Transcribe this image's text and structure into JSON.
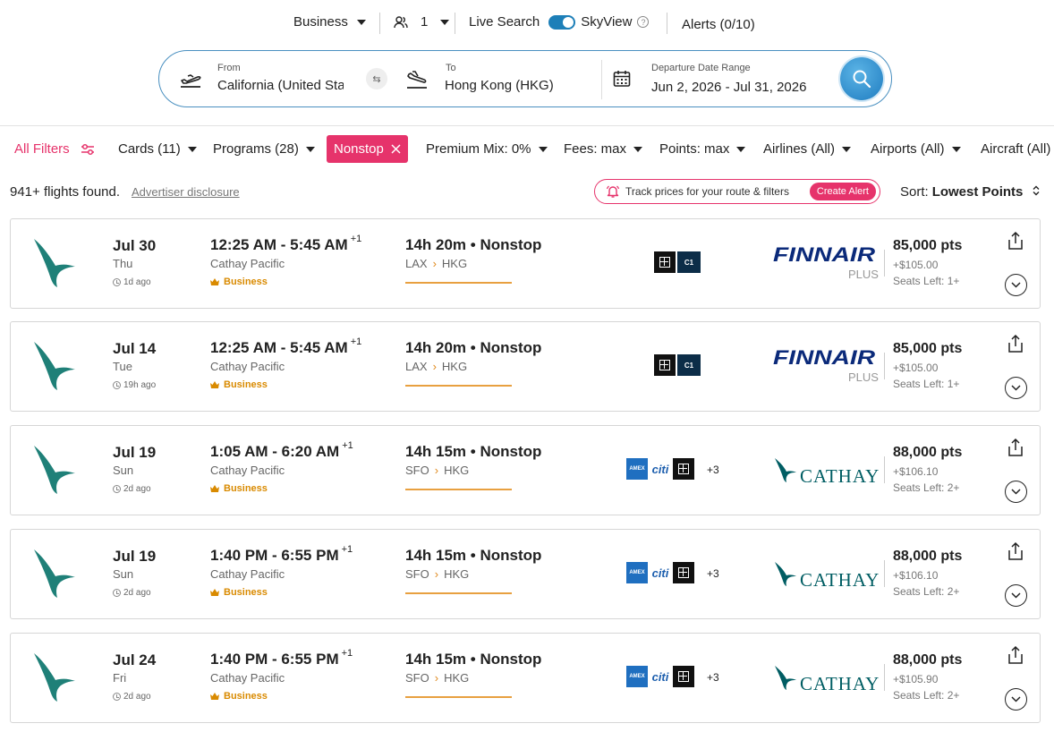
{
  "topbar": {
    "cabin": "Business",
    "passengers": "1",
    "live_search": "Live Search",
    "skyview": "SkyView",
    "alerts": "Alerts (0/10)"
  },
  "search": {
    "from_label": "From",
    "from_value": "California (United States)",
    "to_label": "To",
    "to_value": "Hong Kong (HKG)",
    "date_label": "Departure Date Range",
    "date_value": "Jun 2, 2026 - Jul 31, 2026"
  },
  "filters": {
    "all_filters": "All Filters",
    "cards": "Cards (11)",
    "programs": "Programs (28)",
    "nonstop": "Nonstop",
    "premium_mix": "Premium Mix: 0%",
    "fees": "Fees: max",
    "points": "Points: max",
    "airlines": "Airlines (All)",
    "airports": "Airports (All)",
    "aircraft": "Aircraft (All)"
  },
  "results": {
    "found": "941+ flights found.",
    "disclosure": "Advertiser disclosure",
    "track_text": "Track prices for your route & filters",
    "create_alert": "Create Alert",
    "sort_label": "Sort:",
    "sort_value": "Lowest Points"
  },
  "colors": {
    "accent": "#e6336b",
    "brand_blue": "#1f7cc0",
    "cabin_gold": "#d98a00",
    "finnair": "#0b2a7a",
    "cathay": "#005d63"
  },
  "flights": [
    {
      "date": "Jul 30",
      "dow": "Thu",
      "ago": "1d ago",
      "time": "12:25 AM - 5:45 AM",
      "plus": "+1",
      "airline": "Cathay Pacific",
      "cabin": "Business",
      "duration": "14h 20m • Nonstop",
      "origin": "LAX",
      "dest": "HKG",
      "program": "FINNAIR",
      "program_sub": "PLUS",
      "points": "85,000 pts",
      "fee": "+$105.00",
      "seats": "Seats Left: 1+"
    },
    {
      "date": "Jul 14",
      "dow": "Tue",
      "ago": "19h ago",
      "time": "12:25 AM - 5:45 AM",
      "plus": "+1",
      "airline": "Cathay Pacific",
      "cabin": "Business",
      "duration": "14h 20m • Nonstop",
      "origin": "LAX",
      "dest": "HKG",
      "program": "FINNAIR",
      "program_sub": "PLUS",
      "points": "85,000 pts",
      "fee": "+$105.00",
      "seats": "Seats Left: 1+"
    },
    {
      "date": "Jul 19",
      "dow": "Sun",
      "ago": "2d ago",
      "time": "1:05 AM - 6:20 AM",
      "plus": "+1",
      "airline": "Cathay Pacific",
      "cabin": "Business",
      "duration": "14h 15m • Nonstop",
      "origin": "SFO",
      "dest": "HKG",
      "more_cards": "+3",
      "program": "CATHAY",
      "points": "88,000 pts",
      "fee": "+$106.10",
      "seats": "Seats Left: 2+"
    },
    {
      "date": "Jul 19",
      "dow": "Sun",
      "ago": "2d ago",
      "time": "1:40 PM - 6:55 PM",
      "plus": "+1",
      "airline": "Cathay Pacific",
      "cabin": "Business",
      "duration": "14h 15m • Nonstop",
      "origin": "SFO",
      "dest": "HKG",
      "more_cards": "+3",
      "program": "CATHAY",
      "points": "88,000 pts",
      "fee": "+$106.10",
      "seats": "Seats Left: 2+"
    },
    {
      "date": "Jul 24",
      "dow": "Fri",
      "ago": "2d ago",
      "time": "1:40 PM - 6:55 PM",
      "plus": "+1",
      "airline": "Cathay Pacific",
      "cabin": "Business",
      "duration": "14h 15m • Nonstop",
      "origin": "SFO",
      "dest": "HKG",
      "more_cards": "+3",
      "program": "CATHAY",
      "points": "88,000 pts",
      "fee": "+$105.90",
      "seats": "Seats Left: 2+"
    }
  ]
}
